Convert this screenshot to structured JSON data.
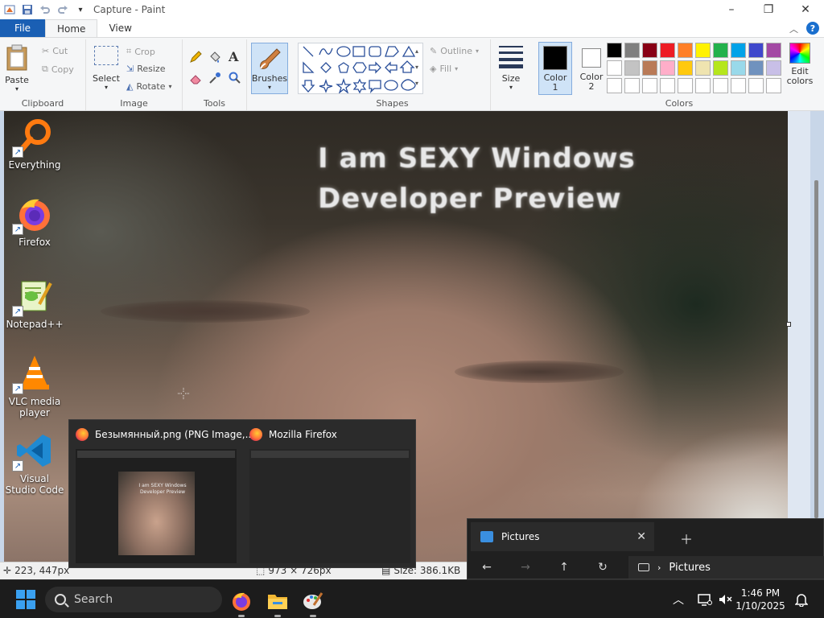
{
  "titlebar": {
    "title": "Capture - Paint",
    "icons": [
      "paint-app-icon",
      "save-icon",
      "undo-icon",
      "redo-icon",
      "customize-qat-icon"
    ],
    "controls": [
      "minimize-icon",
      "maximize-icon",
      "close-icon"
    ]
  },
  "ribbon_tabs": {
    "file": "File",
    "home": "Home",
    "view": "View",
    "help": "?"
  },
  "clipboard": {
    "paste": "Paste",
    "cut": "Cut",
    "copy": "Copy",
    "label": "Clipboard"
  },
  "image": {
    "select": "Select",
    "crop": "Crop",
    "resize": "Resize",
    "rotate": "Rotate",
    "label": "Image"
  },
  "tools": {
    "label": "Tools",
    "text_tool": "A",
    "icons": [
      "pencil-icon",
      "fill-icon",
      "text-icon",
      "eraser-icon",
      "color-picker-icon",
      "magnifier-icon"
    ]
  },
  "brushes": {
    "label": "Brushes"
  },
  "shapes": {
    "outline": "Outline",
    "fill": "Fill",
    "label": "Shapes"
  },
  "size": {
    "label": "Size"
  },
  "colors": {
    "color1": "Color 1",
    "color2": "Color 2",
    "edit_colors": "Edit colors",
    "label": "Colors",
    "color1_value": "#000000",
    "color2_value": "#ffffff",
    "palette_row1": [
      "#000000",
      "#7f7f7f",
      "#880015",
      "#ed1c24",
      "#ff7f27",
      "#fff200",
      "#22b14c",
      "#00a2e8",
      "#3f48cc",
      "#a349a4"
    ],
    "palette_row2": [
      "#ffffff",
      "#c3c3c3",
      "#b97a57",
      "#ffaec9",
      "#ffc90e",
      "#efe4b0",
      "#b5e61d",
      "#99d9ea",
      "#7092be",
      "#c8bfe7"
    ],
    "palette_row3": [
      "#ffffff",
      "#ffffff",
      "#ffffff",
      "#ffffff",
      "#ffffff",
      "#ffffff",
      "#ffffff",
      "#ffffff",
      "#ffffff",
      "#ffffff"
    ]
  },
  "canvas": {
    "caption_line1": "I am SEXY Windows",
    "caption_line2": "Developer Preview"
  },
  "desktop_icons": [
    {
      "label": "Everything",
      "icon": "everything-icon"
    },
    {
      "label": "Firefox",
      "icon": "firefox-icon"
    },
    {
      "label": "Notepad++",
      "icon": "notepad-plus-plus-icon"
    },
    {
      "label": "VLC media player",
      "icon": "vlc-icon"
    },
    {
      "label": "Visual Studio Code",
      "icon": "vscode-icon"
    }
  ],
  "statusbar": {
    "cursor_pos": "223, 447px",
    "dimensions": "973 × 726px",
    "size": "Size: 386.1KB"
  },
  "taskbar_previews": [
    {
      "title": "Безымянный.png (PNG Image,...",
      "mini_caption": "I am SEXY Windows Developer Preview"
    },
    {
      "title": "Mozilla Firefox"
    }
  ],
  "explorer": {
    "tab_title": "Pictures",
    "address": "Pictures",
    "nav_icons": [
      "back-icon",
      "forward-icon",
      "up-icon",
      "refresh-icon"
    ]
  },
  "taskbar": {
    "search_placeholder": "Search",
    "apps": [
      "firefox-taskbar-icon",
      "file-explorer-taskbar-icon",
      "paint-taskbar-icon"
    ],
    "time": "1:46 PM",
    "date": "1/10/2025"
  }
}
